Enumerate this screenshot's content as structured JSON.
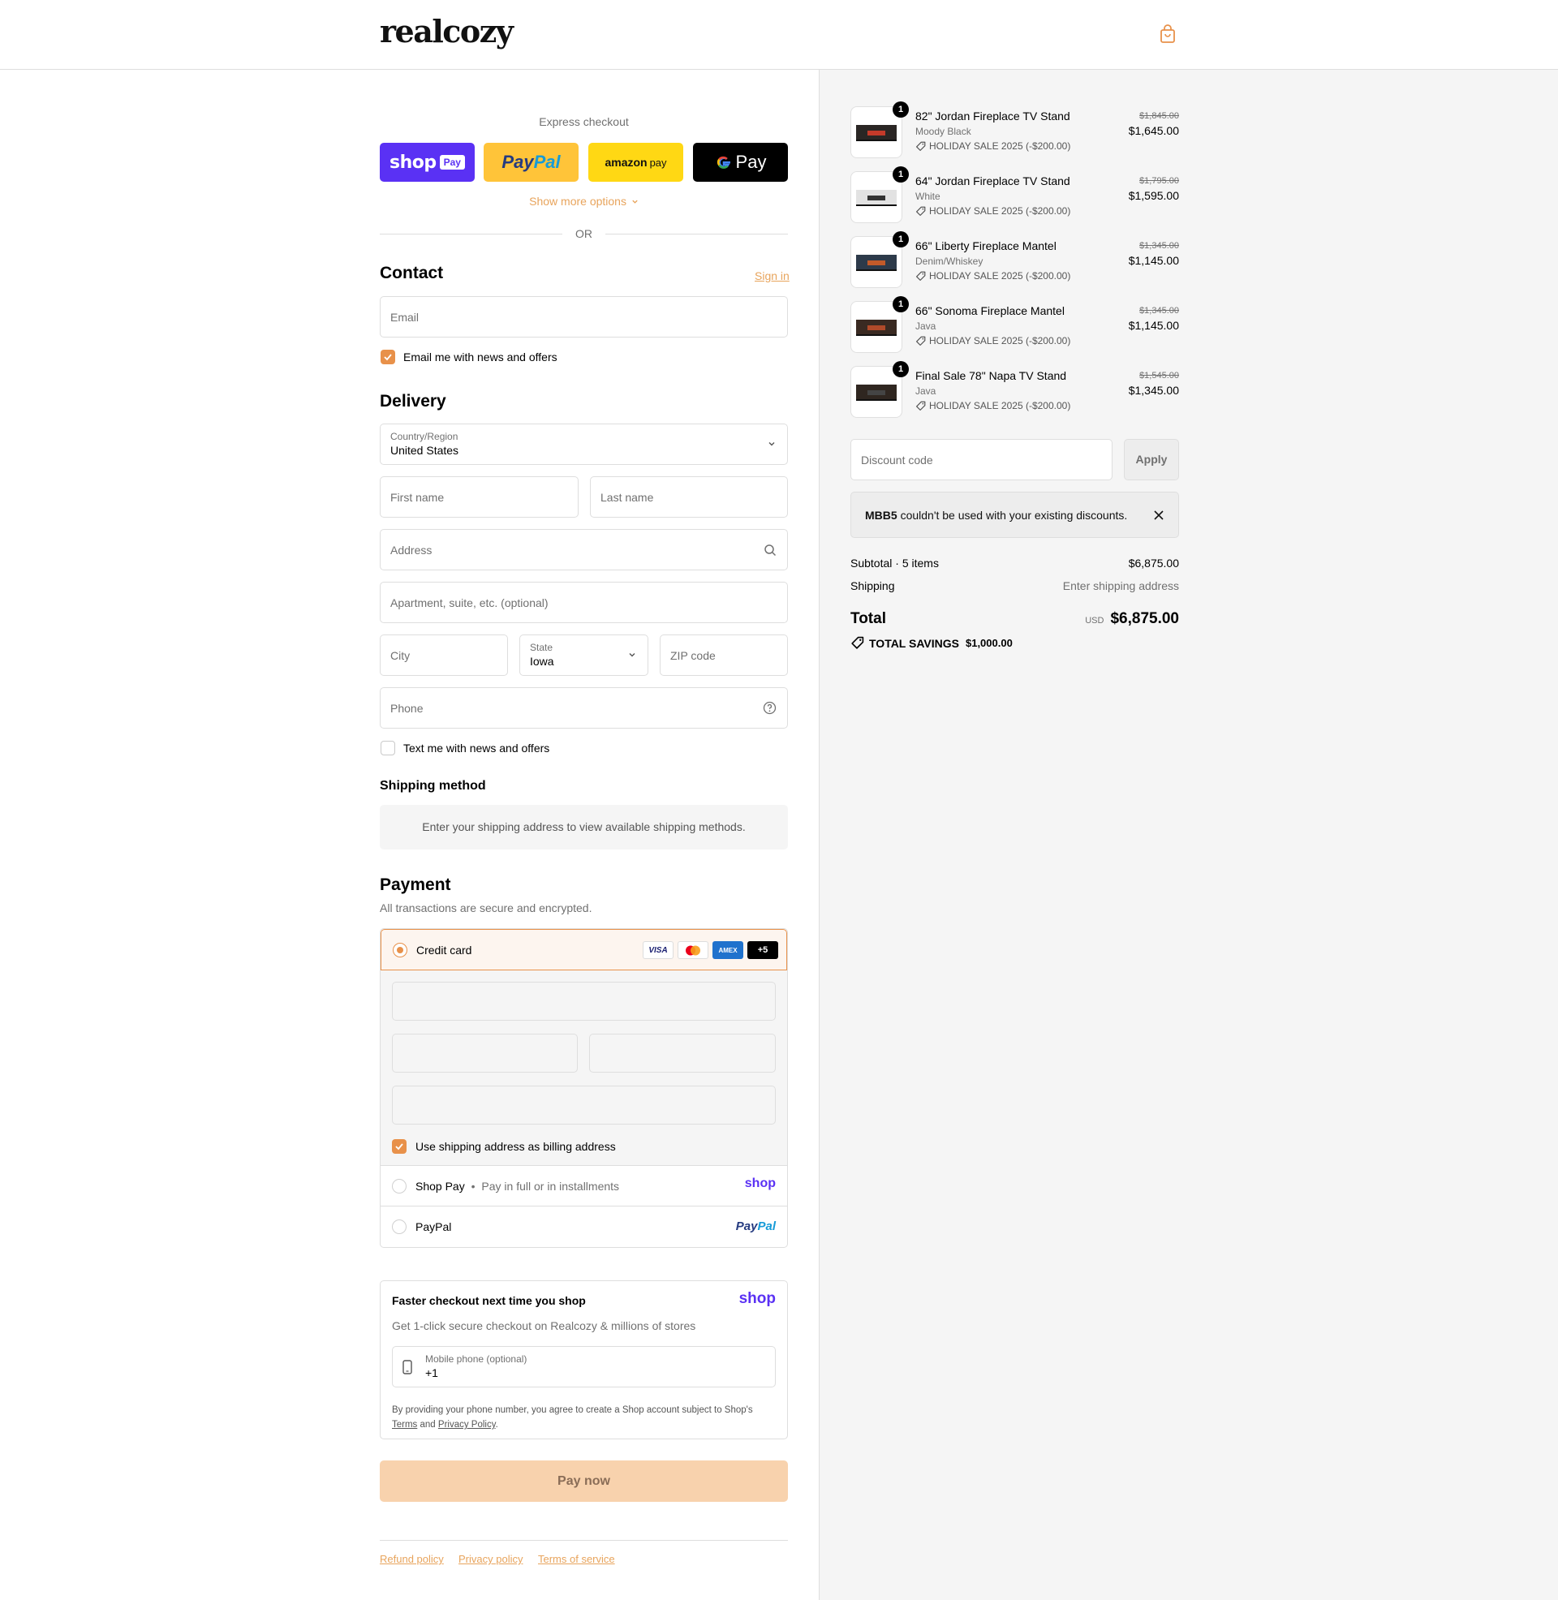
{
  "brand": {
    "name": "realcozy",
    "accent": "#e8914a"
  },
  "express": {
    "label": "Express checkout",
    "shoppay_text": "shop",
    "shoppay_badge": "Pay",
    "paypal_text_a": "Pay",
    "paypal_text_b": "Pal",
    "amazon_text_a": "amazon",
    "amazon_text_b": "pay",
    "gpay_text": "Pay",
    "show_more": "Show more options",
    "or": "OR"
  },
  "contact": {
    "title": "Contact",
    "sign_in": "Sign in",
    "email_placeholder": "Email",
    "news_label": "Email me with news and offers",
    "news_checked": true
  },
  "delivery": {
    "title": "Delivery",
    "country_label": "Country/Region",
    "country_value": "United States",
    "first_name": "First name",
    "last_name": "Last name",
    "address": "Address",
    "apartment": "Apartment, suite, etc. (optional)",
    "city": "City",
    "state_label": "State",
    "state_value": "Iowa",
    "zip": "ZIP code",
    "phone": "Phone",
    "text_label": "Text me with news and offers",
    "text_checked": false
  },
  "shipping": {
    "title": "Shipping method",
    "info": "Enter your shipping address to view available shipping methods."
  },
  "payment": {
    "title": "Payment",
    "subtitle": "All transactions are secure and encrypted.",
    "credit_card": "Credit card",
    "card_logos": [
      "VISA",
      "mastercard",
      "AMEX",
      "+5"
    ],
    "billing_label": "Use shipping address as billing address",
    "billing_checked": true,
    "shoppay_label": "Shop Pay",
    "shoppay_sep": "•",
    "shoppay_desc": "Pay in full or in installments",
    "shoppay_logo": "shop",
    "paypal_label": "PayPal",
    "paypal_logo_a": "Pay",
    "paypal_logo_b": "Pal"
  },
  "shop_promo": {
    "title": "Faster checkout next time you shop",
    "logo": "shop",
    "desc": "Get 1-click secure checkout on Realcozy & millions of stores",
    "phone_label": "Mobile phone (optional)",
    "phone_value": "+1",
    "legal_a": "By providing your phone number, you agree to create a Shop account subject to Shop's",
    "terms": "Terms",
    "and": "and",
    "privacy": "Privacy Policy",
    "period": "."
  },
  "pay_now": "Pay now",
  "footer": [
    "Refund policy",
    "Privacy policy",
    "Terms of service"
  ],
  "cart": {
    "items": [
      {
        "qty": "1",
        "name": "82\" Jordan Fireplace TV Stand",
        "variant": "Moody Black",
        "discount": "HOLIDAY SALE 2025 (-$200.00)",
        "original": "$1,845.00",
        "price": "$1,645.00",
        "thumb": "dark-stand"
      },
      {
        "qty": "1",
        "name": "64\" Jordan Fireplace TV Stand",
        "variant": "White",
        "discount": "HOLIDAY SALE 2025 (-$200.00)",
        "original": "$1,795.00",
        "price": "$1,595.00",
        "thumb": "white-stand"
      },
      {
        "qty": "1",
        "name": "66\" Liberty Fireplace Mantel",
        "variant": "Denim/Whiskey",
        "discount": "HOLIDAY SALE 2025 (-$200.00)",
        "original": "$1,345.00",
        "price": "$1,145.00",
        "thumb": "blue-mantel"
      },
      {
        "qty": "1",
        "name": "66\" Sonoma Fireplace Mantel",
        "variant": "Java",
        "discount": "HOLIDAY SALE 2025 (-$200.00)",
        "original": "$1,345.00",
        "price": "$1,145.00",
        "thumb": "java-mantel"
      },
      {
        "qty": "1",
        "name": "Final Sale 78\" Napa TV Stand",
        "variant": "Java",
        "discount": "HOLIDAY SALE 2025 (-$200.00)",
        "original": "$1,545.00",
        "price": "$1,345.00",
        "thumb": "java-stand"
      }
    ],
    "discount_placeholder": "Discount code",
    "apply": "Apply",
    "error_code": "MBB5",
    "error_msg": "couldn't be used with your existing discounts.",
    "subtotal_label": "Subtotal · 5 items",
    "subtotal_value": "$6,875.00",
    "shipping_label": "Shipping",
    "shipping_value": "Enter shipping address",
    "total_label": "Total",
    "currency": "USD",
    "total_value": "$6,875.00",
    "savings_label": "TOTAL SAVINGS",
    "savings_value": "$1,000.00"
  }
}
